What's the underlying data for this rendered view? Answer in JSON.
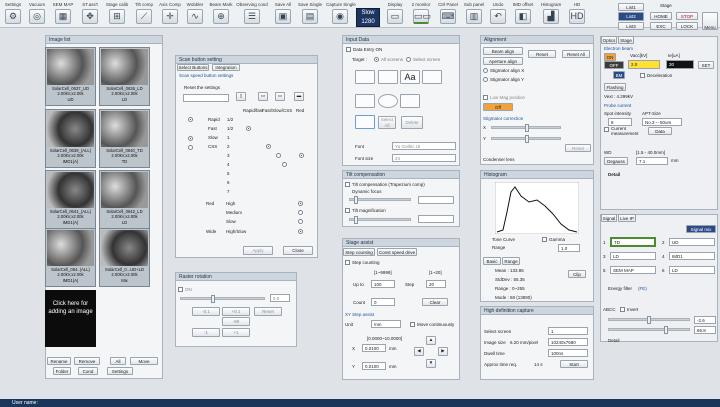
{
  "toolbar": {
    "items": [
      "Settings",
      "Vacuum",
      "SEM MAP",
      "ST.ass't",
      "Stage calib",
      "Tilt comp",
      "Axis Comp",
      "Wobbler",
      "Beam Mark",
      "Observing cond",
      "Save All",
      "Save Single",
      "Capture Single",
      "",
      "Display",
      "2 monitor",
      "Ctrl Panel",
      "Sub panel",
      "Undo",
      "IMD offset",
      "Histogram",
      "HD"
    ],
    "slow_title": "Slow",
    "slow_value": "1280"
  },
  "right_tabs": {
    "list1": "List1",
    "list2": "List2",
    "list3": "List3",
    "stage": "Stage",
    "home": "HOME",
    "stop": "STOP",
    "exc": "EXC",
    "lock": "LOCK",
    "menu": "Menu"
  },
  "image_list": {
    "title": "Image list",
    "thumbs": [
      [
        "SolarCell_0637_UD",
        "2.00kV,x2.00k",
        "UD"
      ],
      [
        "SolarCell_0636_LD",
        "2.00kV,x2.00k",
        "LD"
      ],
      [
        "SolarCell_0639_(ALL)",
        "2.00kV,x2.00k",
        "IMD1(A)"
      ],
      [
        "SolarCell_0640_TD",
        "2.00kV,x2.00k",
        "TD"
      ],
      [
        "SolarCell_0641_(ALL)",
        "2.00kV,x2.00k",
        "IMD1(A)"
      ],
      [
        "SolarCell_0642_LD",
        "2.00kV,x2.00k",
        "LD"
      ],
      [
        "SolarCell_064..(ALL)",
        "2.00kV,x2.00k",
        "IMD1(A)"
      ],
      [
        "SolarCell_0...UD+LD",
        "2.00kV,x2.00k",
        "Mix"
      ]
    ],
    "add": "Click here for adding an image",
    "buttons": {
      "rename": "Rename",
      "remove": "Remove",
      "all": "All",
      "move": "Move",
      "folder": "Folder",
      "cond": "Cond",
      "settings": "Settings"
    }
  },
  "scan": {
    "title": "Scan button setting",
    "tab1": "Select Buttons",
    "tab2": "Integration",
    "sub": "Scan speed button settings",
    "reset": "Reset the settings",
    "hdr1": "Rapid/fast",
    "hdr2": "Fast/Slow/CSS",
    "hdr3": "Red",
    "rows": [
      "Rapid",
      "Fast",
      "Slow",
      "CSS",
      "3",
      "4",
      "5",
      "6",
      "7"
    ],
    "vals": [
      "1/2",
      "1/2",
      "1",
      "2",
      "3",
      "4",
      "5",
      "6",
      "7"
    ],
    "red": "Red",
    "high": "High",
    "medium": "Medium",
    "slow2": "Slow",
    "wide": "Wide",
    "highslow": "High/Slow",
    "apply": "Apply",
    "close": "Close"
  },
  "raster": {
    "title": "Raster rotation",
    "on": "ON",
    "reset": "Reset",
    "b1": "-0.1",
    "b2": "+0.1",
    "b3": "-90",
    "b4": "+90",
    "b5": "-1",
    "b6": "+1",
    "val": "0.0"
  },
  "input": {
    "title": "Input Data",
    "entry": "Data Entry ON",
    "target": "Target :",
    "all": "All screens",
    "sel": "Select screen",
    "selectall": "Select All",
    "delete": "Delete",
    "font": "Font",
    "fontval": "Yu Gothic UI",
    "fontsize": "Font size",
    "sizeval": "24"
  },
  "tilt": {
    "title": "Tilt compensation",
    "comp": "Tilt compensation (Trapezium comp)",
    "focus": "Dynamic focus",
    "mag": "Tilt magnification"
  },
  "stage": {
    "title": "Stage assist",
    "tab1": "Step counting",
    "tab2": "Const speed drive",
    "stepcount": "Step counting",
    "r1": "[1~9999]",
    "r2": "[1~20]",
    "upto": "Up to",
    "uptov": "100",
    "step": "Step",
    "stepv": "20",
    "count": "Count",
    "countv": "0",
    "clear": "Clear",
    "xy": "XY Step assist",
    "unit": "Unit",
    "unitv": "mm",
    "move": "Move continuously",
    "r3": "[0.0000~10.0000]",
    "x": "X",
    "xv": "0.0100",
    "xu": "mm",
    "y": "Y",
    "yv": "0.0100",
    "yu": "mm"
  },
  "align": {
    "title": "Alignment",
    "beam": "Beam align",
    "aper": "Aperture align",
    "sx": "Stigmator align X",
    "sy": "Stigmator align Y",
    "low": "Low Mag position",
    "off": "Off",
    "reset": "Reset",
    "resetall": "Reset All",
    "stig": "Stigmator correction",
    "x": "X",
    "y": "Y",
    "rst": "Reset",
    "cond": "Condenser lens"
  },
  "histo": {
    "title": "Histogram",
    "tone": "Tone Curve",
    "range": "Range",
    "gamma": "Gamma",
    "gv": "1.0",
    "gv2": "0.8",
    "basic": "Basic",
    "rng": "Range",
    "clip": "Clip",
    "mean": "Mean : 133.86",
    "stdev": "StdDev : 55.35",
    "range2": "Range : 0~255",
    "mode": "Mode : 68 (13890)"
  },
  "hd": {
    "title": "High definition capture",
    "sel": "Select screen",
    "selv": "1",
    "size": "Image size",
    "sizeu": "6.20 mm/pixel",
    "sizev": "10240x7680",
    "dwell": "Dwell time",
    "dwellv": "100ns",
    "approx": "Approx time req.",
    "approxv": "14 s",
    "start": "Start"
  },
  "optics": {
    "tab1": "Optics",
    "tab2": "Stage",
    "eb": "Electron beam",
    "vacc": "Vacc[kV]",
    "ie": "Ie[uA]",
    "vaccv": "2.0",
    "iev": "30",
    "set": "SET",
    "on": "ON",
    "off": "OFF",
    "bm": "BM",
    "decel": "Deceleration",
    "flash": "Flashing",
    "vext": "Vext : 4.299kV",
    "probe": "Probe current",
    "spot": "Spot intensity",
    "apt": "APT-Size",
    "spotv": "8",
    "aptv": "No.3 -- 50um",
    "curr": "Current measurement",
    "data": "Data",
    "wd": "WD",
    "wdr": "[1.5 - 40.0mm]",
    "deg": "Degauss",
    "wdv": "7.1",
    "mm": "mm",
    "detail": "Detail"
  },
  "signal": {
    "tab1": "Signal",
    "tab2": "Live IP",
    "mix": "Signal mix",
    "s1": "TD",
    "s2": "UD",
    "s3": "LD",
    "s4": "IMD1",
    "s5": "SEM MAP",
    "s6": "LD",
    "n1": "1",
    "n2": "2",
    "n3": "3",
    "n4": "4",
    "n5": "5",
    "n6": "6",
    "ef": "Energy filter",
    "fe": "(FE)",
    "abcc": "ABCC",
    "invert": "Invert",
    "v1": "-2.6",
    "v2": "66.8",
    "detail": "Detail"
  },
  "status": {
    "user": "User name:"
  },
  "colors": {
    "accent": "#4b8c2e",
    "navy": "#1b355b",
    "orange": "#f2a23a",
    "yellow": "#ffe033",
    "red": "#e33"
  }
}
